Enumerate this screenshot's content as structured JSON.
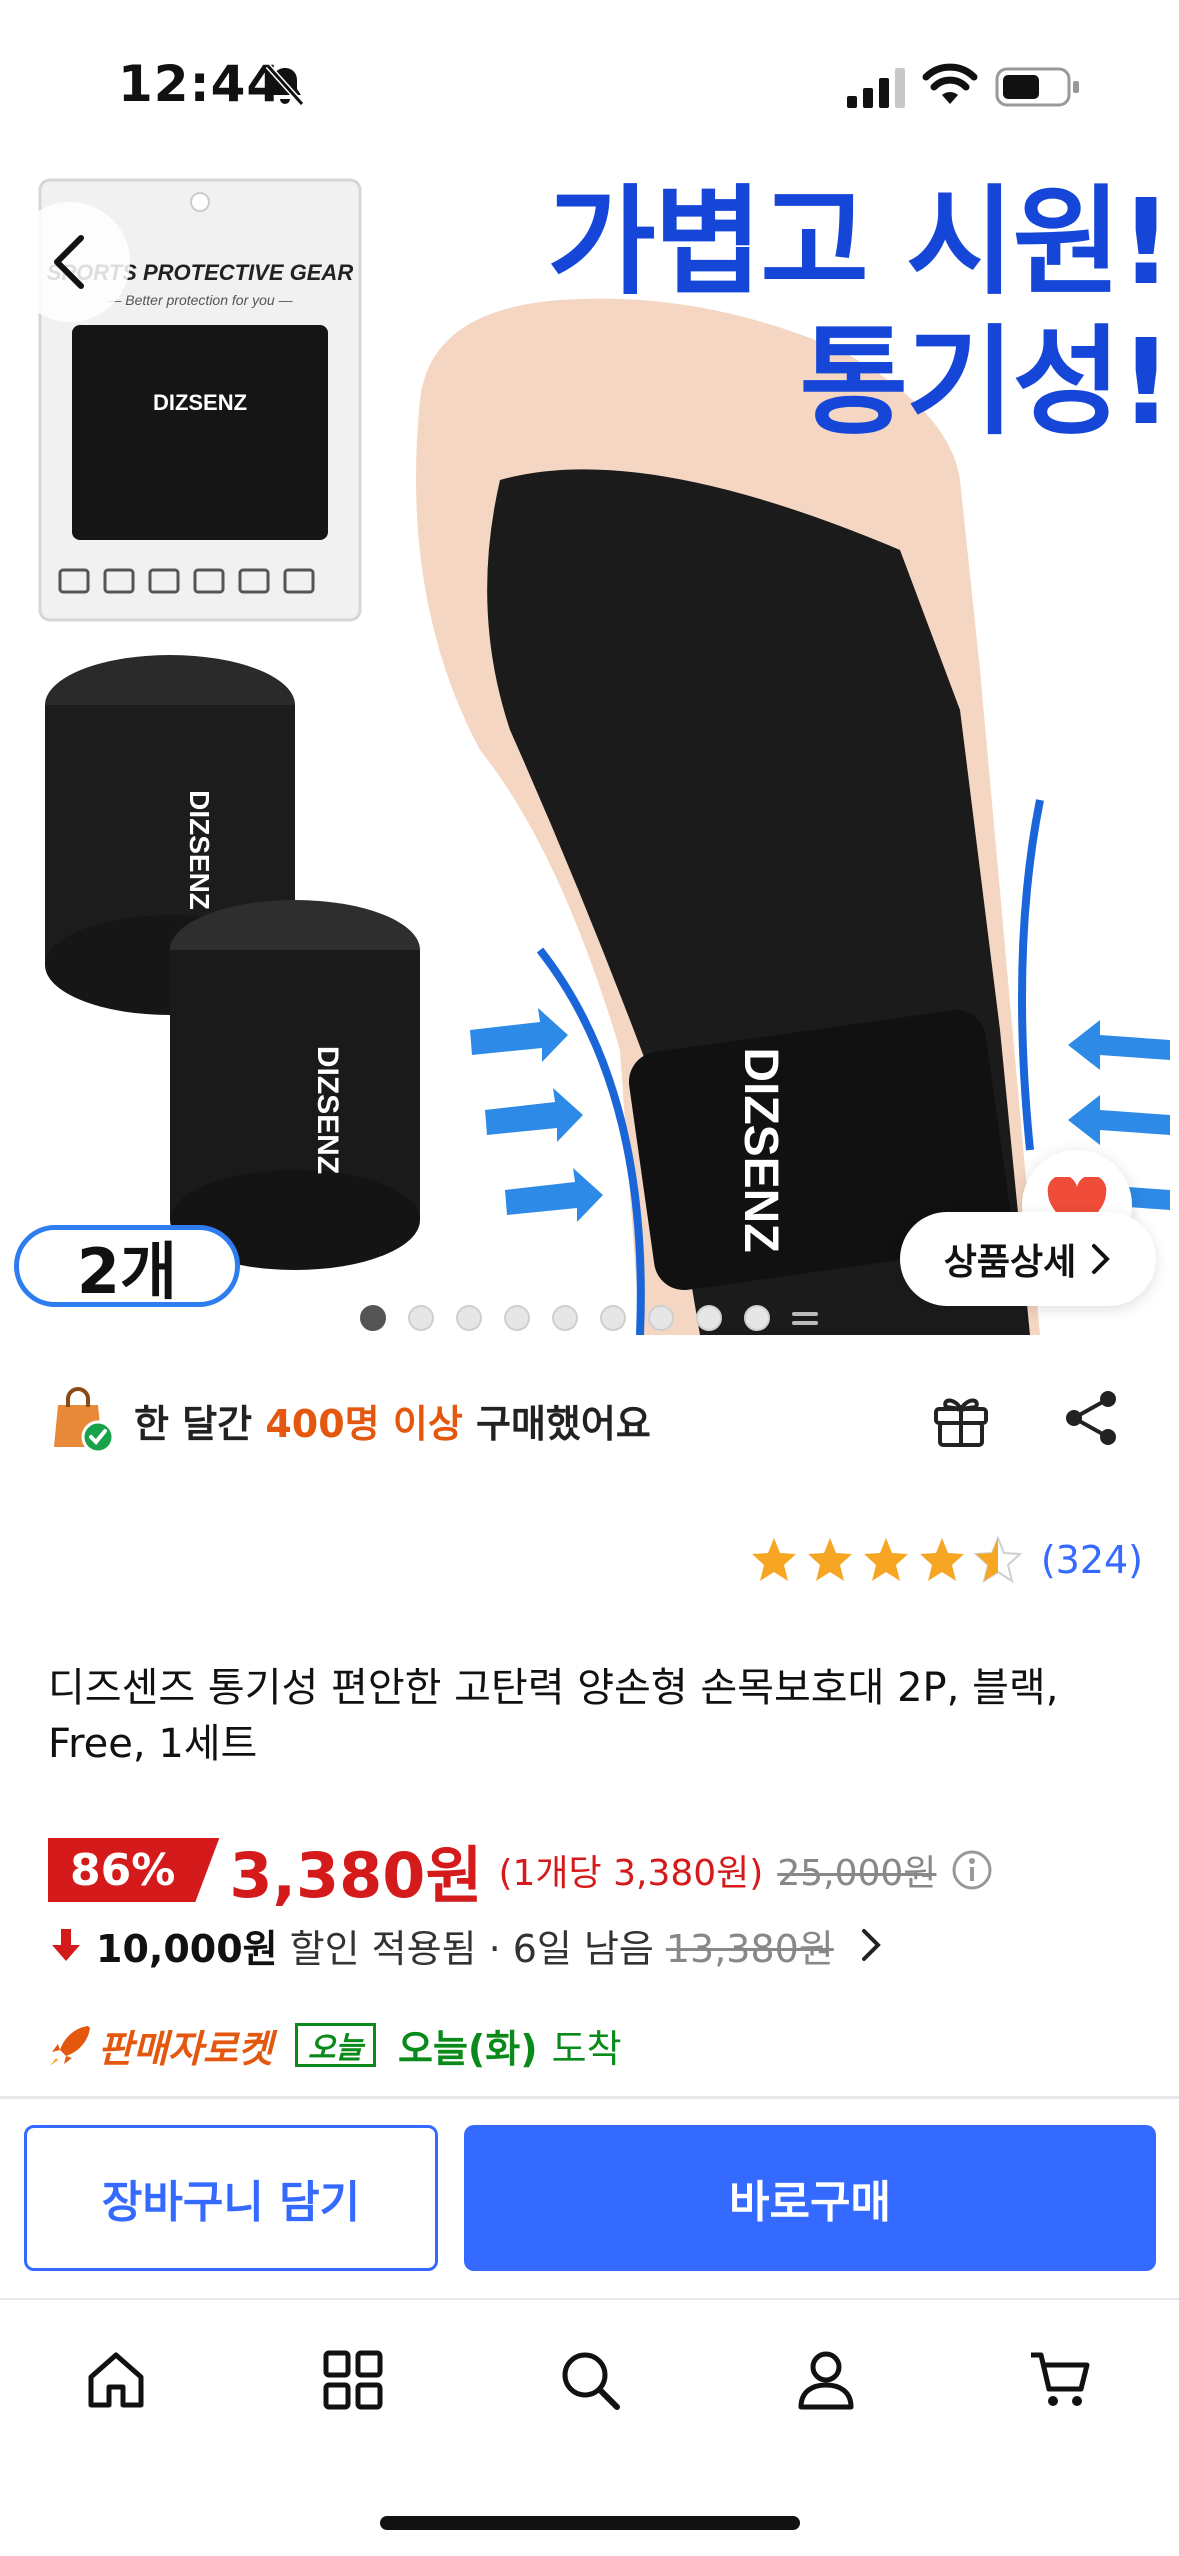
{
  "status_bar": {
    "time": "12:44"
  },
  "hero": {
    "headline_line1": "가볍고 시원!",
    "headline_line2": "통기성!",
    "package_title": "SPORTS PROTECTIVE GEAR",
    "package_subtitle": "— Better protection for you —",
    "brand": "DIZSENZ",
    "badge": "2개",
    "detail_button": "상품상세",
    "image_count": 10,
    "active_image": 1
  },
  "purchase_info": {
    "prefix": "한 달간 ",
    "highlight": "400명 이상",
    "suffix": " 구매했어요"
  },
  "rating": {
    "stars": 4.5,
    "count": "(324)"
  },
  "product_title": "디즈센즈 통기성 편안한 고탄력 양손형 손목보호대 2P, 블랙, Free, 1세트",
  "price": {
    "discount": "86%",
    "final": "3,380원",
    "unit": "(1개당 3,380원)",
    "original": "25,000원"
  },
  "coupon": {
    "amount": "10,000원",
    "text": "할인 적용됨 · 6일 남음",
    "price_before": "13,380원"
  },
  "shipping": {
    "seller_rocket": "판매자로켓",
    "today_tag": "오늘",
    "date": "오늘(화)",
    "arrive": "도착"
  },
  "actions": {
    "cart": "장바구니 담기",
    "buy_now": "바로구매"
  },
  "colors": {
    "accent_blue": "#346aff",
    "sale_red": "#d41a1a",
    "rocket_orange": "#e4570e",
    "delivery_green": "#0a8a1a"
  },
  "tabbar": {
    "icons": [
      "home-icon",
      "category-icon",
      "search-icon",
      "user-icon",
      "cart-icon"
    ]
  }
}
